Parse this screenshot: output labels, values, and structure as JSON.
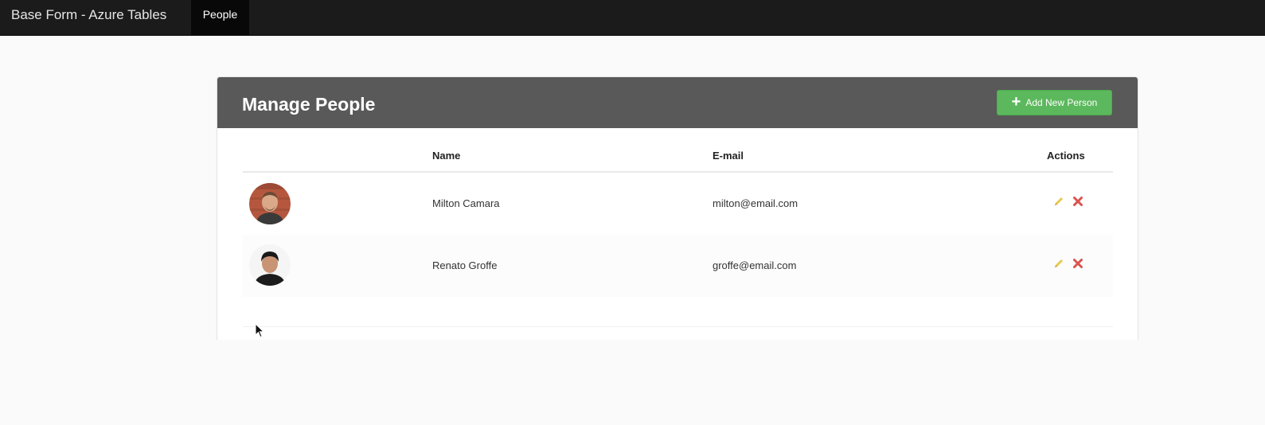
{
  "navbar": {
    "brand": "Base Form - Azure Tables",
    "items": [
      {
        "label": "People",
        "active": true
      }
    ]
  },
  "panel": {
    "title": "Manage People",
    "add_button": {
      "label": "Add New Person",
      "icon": "plus-icon"
    }
  },
  "table": {
    "columns": [
      "",
      "Name",
      "E-mail",
      "Actions"
    ],
    "rows": [
      {
        "name": "Milton Camara",
        "email": "milton@email.com",
        "actions": [
          "pencil-icon",
          "delete-icon"
        ]
      },
      {
        "name": "Renato Groffe",
        "email": "groffe@email.com",
        "actions": [
          "pencil-icon",
          "delete-icon"
        ]
      }
    ]
  },
  "colors": {
    "navbar": "#1b1b1b",
    "panel_heading": "#595959",
    "add_button": "#5cb85c",
    "edit_icon": "#e8c84a",
    "delete_icon": "#d9534f"
  }
}
